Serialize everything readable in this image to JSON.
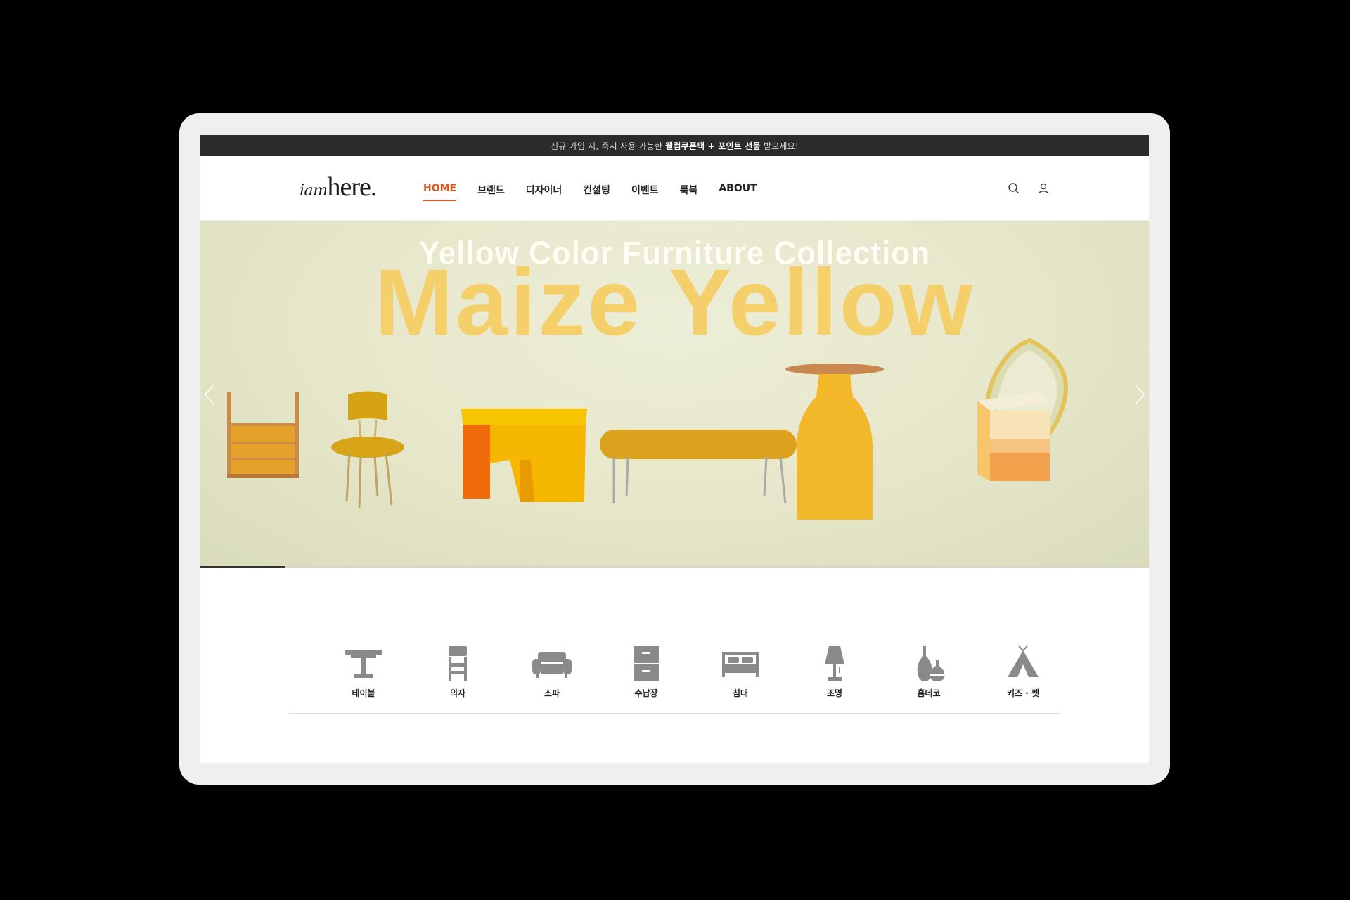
{
  "promo": {
    "prefix": "신규 가입 시, 즉시 사용 가능한",
    "highlight": "웰컴쿠폰팩 + 포인트 선물",
    "suffix": "받으세요!"
  },
  "header": {
    "logo_part1": "iam",
    "logo_part2": "here.",
    "nav": [
      "HOME",
      "브랜드",
      "디자이너",
      "컨설팅",
      "이벤트",
      "룩북",
      "ABOUT"
    ],
    "active_nav": "HOME",
    "icons": [
      "search-icon",
      "user-icon"
    ]
  },
  "hero": {
    "subtitle": "Yellow Color Furniture Collection",
    "title": "Maize Yellow",
    "slide_progress": 0.09
  },
  "categories": [
    {
      "label": "테이블",
      "icon": "table-icon"
    },
    {
      "label": "의자",
      "icon": "chair-icon"
    },
    {
      "label": "소파",
      "icon": "sofa-icon"
    },
    {
      "label": "수납장",
      "icon": "cabinet-icon"
    },
    {
      "label": "침대",
      "icon": "bed-icon"
    },
    {
      "label": "조명",
      "icon": "lamp-icon"
    },
    {
      "label": "홈데코",
      "icon": "vase-icon"
    },
    {
      "label": "키즈 · 펫",
      "icon": "tent-icon"
    }
  ],
  "colors": {
    "accent": "#e0531a",
    "promo_bg": "#2b2b2b",
    "hero_title": "#f5cf6a",
    "icon_gray": "#8a8a8a"
  }
}
